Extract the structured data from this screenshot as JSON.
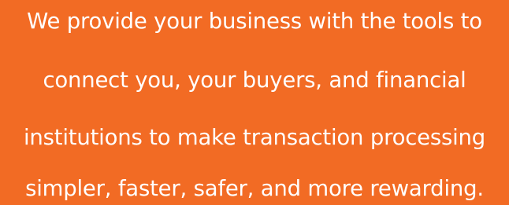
{
  "banner": {
    "lines": [
      "We provide your business with the tools to",
      "connect you, your buyers, and financial",
      "institutions to make transaction processing",
      "simpler, faster, safer, and more rewarding."
    ],
    "background_color": "#f26b24",
    "text_color": "#ffffff"
  }
}
